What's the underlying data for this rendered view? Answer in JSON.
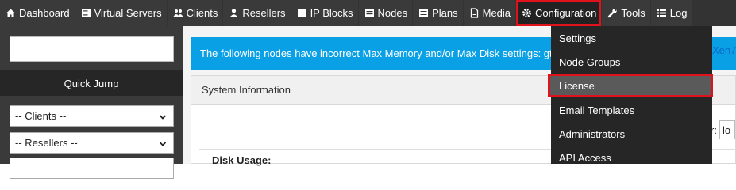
{
  "nav": {
    "items": [
      {
        "label": "Dashboard",
        "icon": "home-icon"
      },
      {
        "label": "Virtual Servers",
        "icon": "server-icon"
      },
      {
        "label": "Clients",
        "icon": "users-icon"
      },
      {
        "label": "Resellers",
        "icon": "user-icon"
      },
      {
        "label": "IP Blocks",
        "icon": "grid-icon"
      },
      {
        "label": "Nodes",
        "icon": "nodes-icon"
      },
      {
        "label": "Plans",
        "icon": "list-icon"
      },
      {
        "label": "Media",
        "icon": "file-icon"
      },
      {
        "label": "Configuration",
        "icon": "gear-icon"
      },
      {
        "label": "Tools",
        "icon": "wrench-icon"
      },
      {
        "label": "Log",
        "icon": "log-list-icon"
      }
    ]
  },
  "sidebar": {
    "search_value": "",
    "quick_jump_label": "Quick Jump",
    "clients_select": "-- Clients --",
    "resellers_select": "-- Resellers --"
  },
  "alert": {
    "text": "The following nodes have incorrect Max Memory and/or Max Disk settings: gt",
    "link_fragment": "Xen7"
  },
  "panel": {
    "title": "System Information",
    "disk_usage_label": "Disk Usage:",
    "filter_label": "er:",
    "filter_value": "lo"
  },
  "config_menu": {
    "items": [
      "Settings",
      "Node Groups",
      "License",
      "Email Templates",
      "Administrators",
      "API Access"
    ],
    "active": "License"
  },
  "colors": {
    "nav_bg": "#333333",
    "alert_bg": "#0aa0e6",
    "highlight": "#e0121b",
    "dropdown_bg": "#262626"
  }
}
